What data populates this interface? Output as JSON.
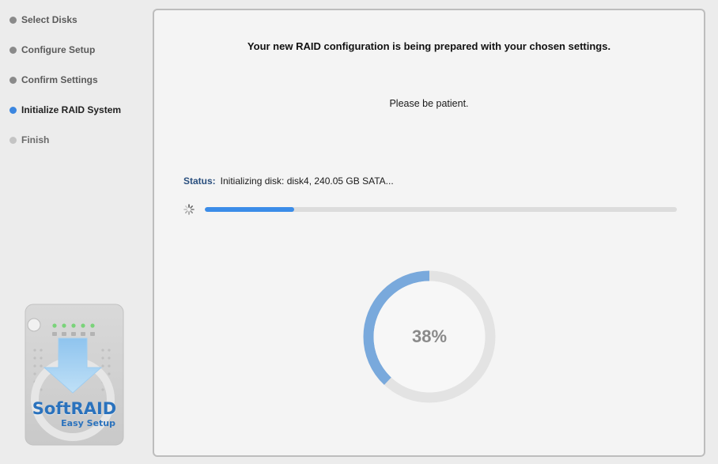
{
  "sidebar": {
    "steps": [
      {
        "label": "Select Disks",
        "state": "done"
      },
      {
        "label": "Configure Setup",
        "state": "done"
      },
      {
        "label": "Confirm Settings",
        "state": "done"
      },
      {
        "label": "Initialize RAID System",
        "state": "current"
      },
      {
        "label": "Finish",
        "state": "pending"
      }
    ]
  },
  "logo": {
    "name": "SoftRAID",
    "subtitle": "Easy Setup",
    "icon": "disk-enclosure-download-icon"
  },
  "main": {
    "headline": "Your new RAID configuration is being prepared with your chosen settings.",
    "patience_text": "Please be patient.",
    "status_label": "Status:",
    "status_text": "Initializing disk: disk4, 240.05 GB SATA...",
    "progress_bar_fraction": 0.19,
    "spinner_icon": "activity-spinner-icon",
    "ring_percent": 38,
    "ring_label": "38%"
  },
  "colors": {
    "accent": "#3b86e0",
    "ring_fill": "#79a9dc",
    "ring_track": "#e3e3e3",
    "status_label": "#2a4f7e",
    "brand": "#2a72bd"
  }
}
